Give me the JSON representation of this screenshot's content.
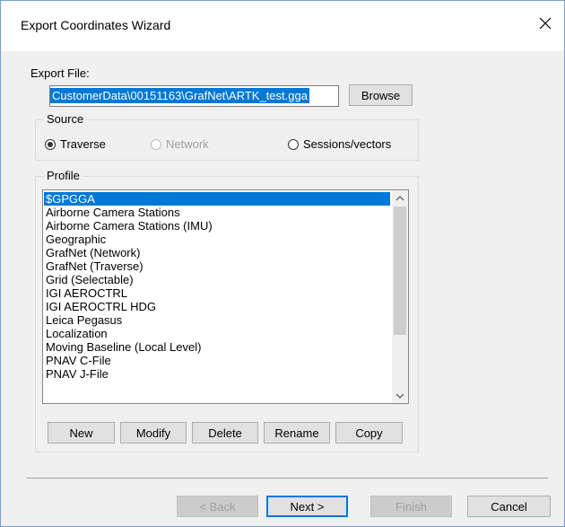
{
  "window": {
    "title": "Export Coordinates Wizard",
    "close_icon": "close-icon"
  },
  "export_file": {
    "label": "Export File:",
    "path": "CustomerData\\00151163\\GrafNet\\ARTK_test.gga",
    "browse_label": "Browse"
  },
  "source": {
    "label": "Source",
    "options": [
      {
        "label": "Traverse",
        "checked": true,
        "enabled": true
      },
      {
        "label": "Network",
        "checked": false,
        "enabled": false
      },
      {
        "label": "Sessions/vectors",
        "checked": false,
        "enabled": true
      }
    ]
  },
  "profile": {
    "label": "Profile",
    "items": [
      "$GPGGA",
      "Airborne Camera Stations",
      "Airborne Camera Stations (IMU)",
      "Geographic",
      "GrafNet (Network)",
      "GrafNet (Traverse)",
      "Grid (Selectable)",
      "IGI AEROCTRL",
      "IGI AEROCTRL HDG",
      "Leica Pegasus",
      "Localization",
      "Moving Baseline (Local Level)",
      "PNAV C-File",
      "PNAV J-File"
    ],
    "selected": "$GPGGA",
    "buttons": {
      "new": "New",
      "modify": "Modify",
      "delete": "Delete",
      "rename": "Rename",
      "copy": "Copy"
    }
  },
  "wizard_buttons": {
    "back": "< Back",
    "next": "Next >",
    "finish": "Finish",
    "cancel": "Cancel"
  },
  "colors": {
    "selection": "#0078d7",
    "dialog_bg": "#f0f0f0"
  }
}
